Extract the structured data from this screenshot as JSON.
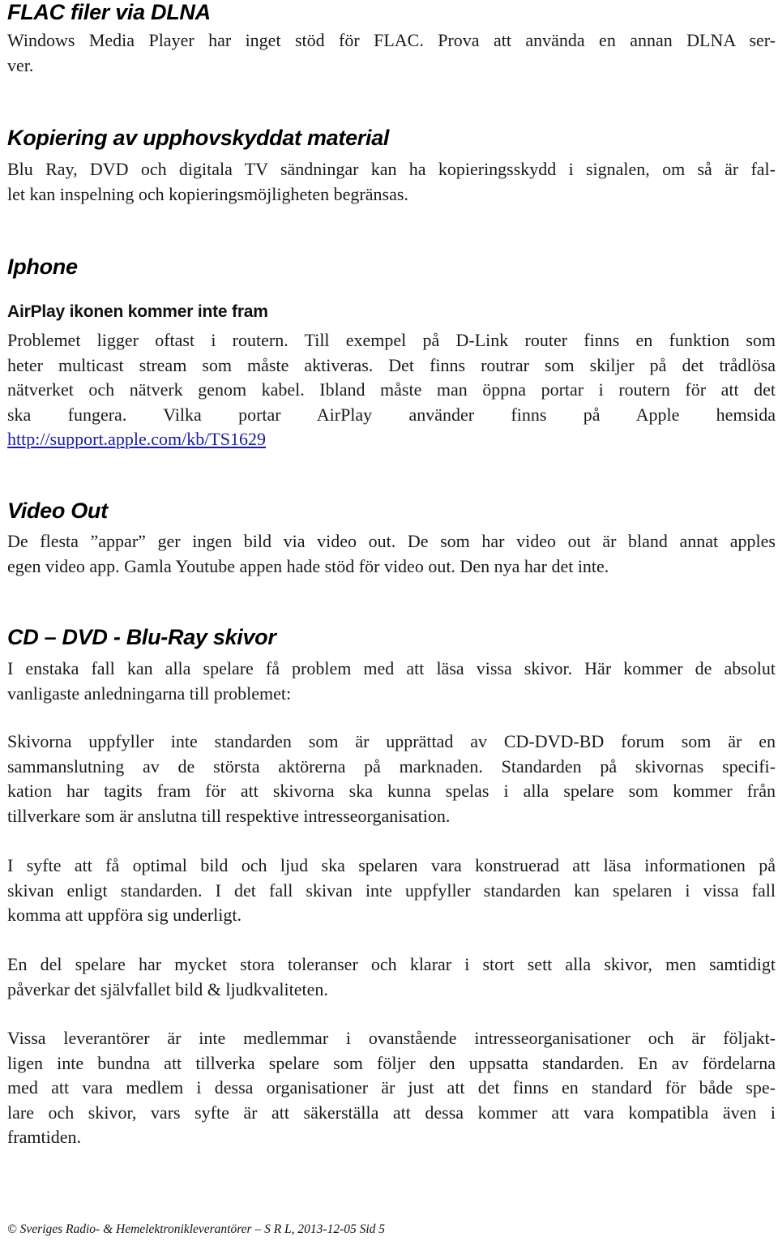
{
  "sections": {
    "flac": {
      "heading": "FLAC filer via DLNA",
      "lines": [
        "Windows Media Player har inget stöd för FLAC. Prova att använda en annan DLNA ser-",
        "ver."
      ]
    },
    "copy": {
      "heading": "Kopiering av upphovskyddat material",
      "lines": [
        "Blu Ray, DVD och digitala TV sändningar kan ha kopieringsskydd i signalen, om så är fal-",
        "let kan inspelning och kopieringsmöjligheten begränsas."
      ]
    },
    "iphone": {
      "heading": "Iphone",
      "subheading": "AirPlay ikonen kommer inte fram",
      "lines": [
        "Problemet ligger oftast i routern. Till exempel på D-Link router finns en funktion som",
        "heter multicast stream som måste aktiveras. Det finns routrar som skiljer på det trådlösa",
        "nätverket och nätverk genom kabel. Ibland måste man öppna portar i routern för att det",
        "ska fungera. Vilka portar AirPlay använder finns på Apple hemsida"
      ],
      "link": "http://support.apple.com/kb/TS1629"
    },
    "video": {
      "heading": "Video Out",
      "lines": [
        "De flesta ”appar” ger ingen bild via video out. De som har video out är bland annat apples",
        "egen video app. Gamla Youtube appen hade stöd för video out. Den nya har det inte."
      ]
    },
    "discs": {
      "heading": "CD – DVD - Blu-Ray skivor",
      "p1": [
        "I enstaka fall kan alla spelare få problem med att läsa vissa skivor. Här kommer de absolut",
        "vanligaste anledningarna till problemet:"
      ],
      "p2": [
        "Skivorna uppfyller inte standarden som är upprättad av CD-DVD-BD forum som är en",
        "sammanslutning av de största aktörerna på marknaden. Standarden på skivornas specifi-",
        "kation har tagits fram för att skivorna ska kunna spelas i alla spelare som kommer från",
        "tillverkare som är anslutna till respektive intresseorganisation."
      ],
      "p3": [
        "I syfte att få optimal bild och ljud ska spelaren vara konstruerad att läsa informationen på",
        "skivan enligt standarden. I det fall skivan inte uppfyller standarden kan spelaren i vissa fall",
        "komma att uppföra sig underligt."
      ],
      "p4": [
        "En del spelare har mycket stora toleranser och klarar i stort sett alla skivor, men samtidigt",
        "påverkar det självfallet bild & ljudkvaliteten."
      ],
      "p5": [
        "Vissa leverantörer är inte medlemmar i ovanstående intresseorganisationer och är följakt-",
        "ligen inte bundna att tillverka spelare som följer den uppsatta standarden. En av fördelarna",
        "med att vara medlem i dessa organisationer är just att det finns en standard för både spe-",
        "lare och skivor, vars syfte är att säkerställa att dessa kommer att vara kompatibla även i",
        "framtiden."
      ]
    }
  },
  "footer": {
    "text": "© Sveriges Radio- & Hemelektronikleverantörer – S R L, 2013-12-05  Sid 5"
  },
  "colors": {
    "link": "#1a1aa6",
    "text": "#1a1a1a"
  }
}
